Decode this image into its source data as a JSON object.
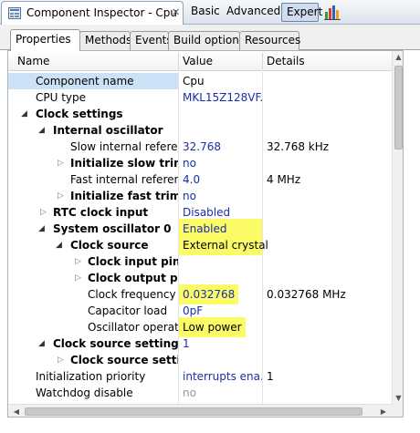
{
  "view": {
    "title": "Component Inspector - Cpu",
    "close": "✕",
    "icon": "component-inspector-icon"
  },
  "modes": {
    "basic": "Basic",
    "advanced": "Advanced",
    "expert": "Expert",
    "chart_icon": "bar-chart-icon"
  },
  "tabs": [
    "Properties",
    "Methods",
    "Events",
    "Build options",
    "Resources"
  ],
  "columns": {
    "name": "Name",
    "value": "Value",
    "details": "Details"
  },
  "rows": [
    {
      "name": "Component name",
      "value": "Cpu",
      "details": "",
      "selected": true
    },
    {
      "name": "CPU type",
      "value": "MKL15Z128VF...",
      "details": ""
    },
    {
      "name": "Clock settings",
      "value": "",
      "details": ""
    },
    {
      "name": "Internal oscillator",
      "value": "",
      "details": ""
    },
    {
      "name": "Slow internal reference",
      "value": "32.768",
      "details": "32.768 kHz"
    },
    {
      "name": "Initialize slow trim va",
      "value": "no",
      "details": ""
    },
    {
      "name": "Fast internal reference",
      "value": "4.0",
      "details": "4 MHz"
    },
    {
      "name": "Initialize fast trim val",
      "value": "no",
      "details": ""
    },
    {
      "name": "RTC clock input",
      "value": "Disabled",
      "details": ""
    },
    {
      "name": "System oscillator 0",
      "value": "Enabled",
      "details": ""
    },
    {
      "name": "Clock source",
      "value": "External crystal",
      "details": ""
    },
    {
      "name": "Clock input pin",
      "value": "",
      "details": ""
    },
    {
      "name": "Clock output pin",
      "value": "",
      "details": ""
    },
    {
      "name": "Clock frequency [M",
      "value": "0.032768",
      "details": "0.032768 MHz"
    },
    {
      "name": "Capacitor load",
      "value": "0pF",
      "details": ""
    },
    {
      "name": "Oscillator operating",
      "value": "Low power",
      "details": ""
    },
    {
      "name": "Clock source settings",
      "value": "1",
      "details": ""
    },
    {
      "name": "Clock source setting 0",
      "value": "",
      "details": ""
    },
    {
      "name": "Initialization priority",
      "value": "interrupts ena...",
      "details": "1"
    },
    {
      "name": "Watchdog disable",
      "value": "no",
      "details": ""
    }
  ],
  "colors": {
    "highlight": "#fbfb68",
    "value_text": "#1a2da8",
    "selection": "#cde1f6"
  }
}
